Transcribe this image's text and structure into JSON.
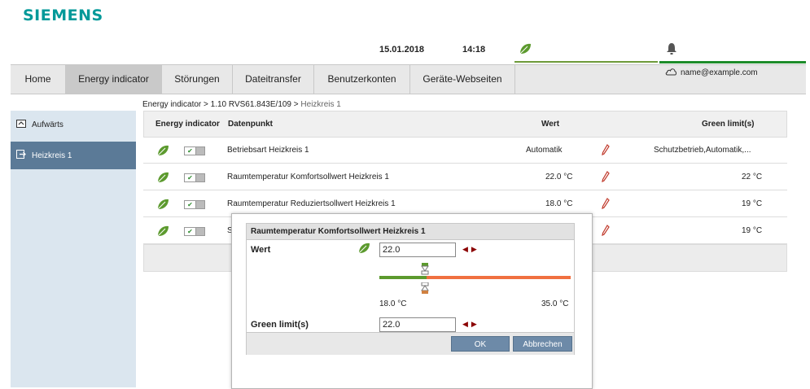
{
  "brand": "SIEMENS",
  "topbar": {
    "date": "15.01.2018",
    "time": "14:18",
    "user": "name@example.com"
  },
  "nav": {
    "tabs": [
      {
        "label": "Home"
      },
      {
        "label": "Energy indicator"
      },
      {
        "label": "Störungen"
      },
      {
        "label": "Dateitransfer"
      },
      {
        "label": "Benutzerkonten"
      },
      {
        "label": "Geräte-Webseiten"
      }
    ],
    "active_tab": "Energy indicator"
  },
  "breadcrumb": {
    "path": "Energy indicator > 1.10 RVS61.843E/109 > ",
    "current": "Heizkreis 1"
  },
  "sidebar": {
    "up_label": "Aufwärts",
    "items": [
      {
        "label": "Heizkreis 1"
      }
    ]
  },
  "table": {
    "headers": {
      "indicator": "Energy indicator",
      "datapoint": "Datenpunkt",
      "value": "Wert",
      "green_limits": "Green limit(s)"
    },
    "rows": [
      {
        "datapoint": "Betriebsart Heizkreis 1",
        "value": "Automatik",
        "green_limits": "Schutzbetrieb,Automatik,..."
      },
      {
        "datapoint": "Raumtemperatur Komfortsollwert Heizkreis 1",
        "value": "22.0 °C",
        "green_limits": "22 °C"
      },
      {
        "datapoint": "Raumtemperatur Reduziertsollwert Heizkreis 1",
        "value": "18.0 °C",
        "green_limits": "19 °C"
      },
      {
        "datapoint": "S",
        "value": "",
        "green_limits": "19 °C"
      }
    ]
  },
  "dialog": {
    "title": "Raumtemperatur Komfortsollwert Heizkreis 1",
    "value_label": "Wert",
    "value": "22.0",
    "range_min": "18.0 °C",
    "range_max": "35.0 °C",
    "green_limit_label": "Green limit(s)",
    "green_limit_value": "22.0",
    "ok_label": "OK",
    "cancel_label": "Abbrechen"
  },
  "colors": {
    "brand": "#009999",
    "leaf": "#5c9a2e",
    "slider_green": "#5c9a2e",
    "slider_orange": "#f07040",
    "button": "#6d8aa8",
    "sidebar_active": "#5b7a97",
    "pencil": "#c0392b"
  }
}
